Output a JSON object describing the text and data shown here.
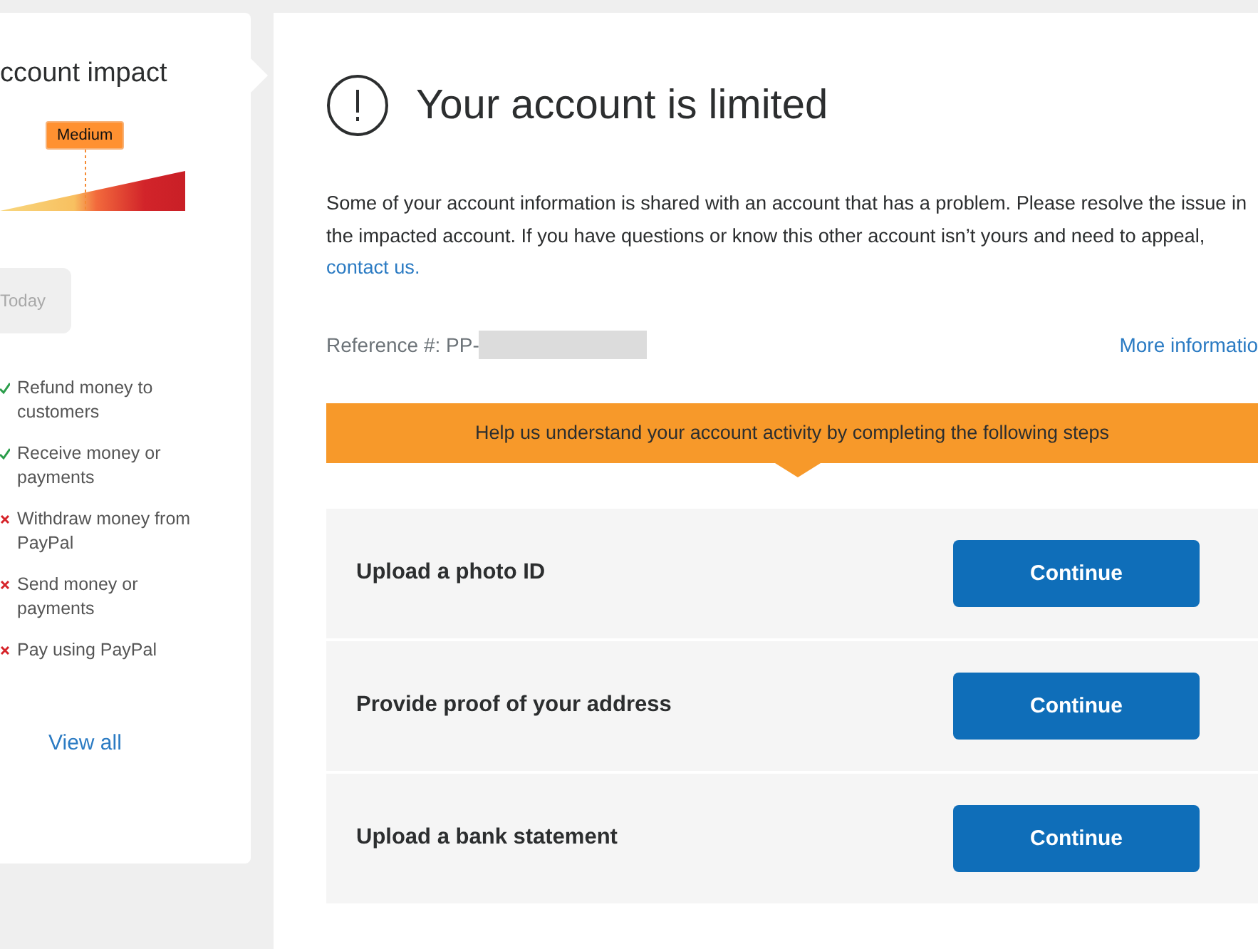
{
  "impact_card": {
    "title": "ccount impact",
    "meter_label": "Medium",
    "today_label": "Today",
    "capabilities": [
      {
        "label": "Refund money to customers",
        "allowed": true
      },
      {
        "label": "Receive money or payments",
        "allowed": true
      },
      {
        "label": "Withdraw money from PayPal",
        "allowed": false
      },
      {
        "label": "Send money or payments",
        "allowed": false
      },
      {
        "label": "Pay using PayPal",
        "allowed": false
      }
    ],
    "view_all": "View all"
  },
  "main": {
    "title": "Your account is limited",
    "message": "Some of your account information is shared with an account that has a problem. Please resolve the issue in the impacted account. If you have questions or know this other account isn’t yours and need to appeal,",
    "contact_link": "contact us.",
    "reference_label": "Reference #: PP-",
    "more_info": "More informatio",
    "banner": "Help us understand your account activity by completing the following steps",
    "steps": [
      {
        "label": "Upload a photo ID",
        "button": "Continue"
      },
      {
        "label": "Provide proof of your address",
        "button": "Continue"
      },
      {
        "label": "Upload a bank statement",
        "button": "Continue"
      }
    ]
  }
}
